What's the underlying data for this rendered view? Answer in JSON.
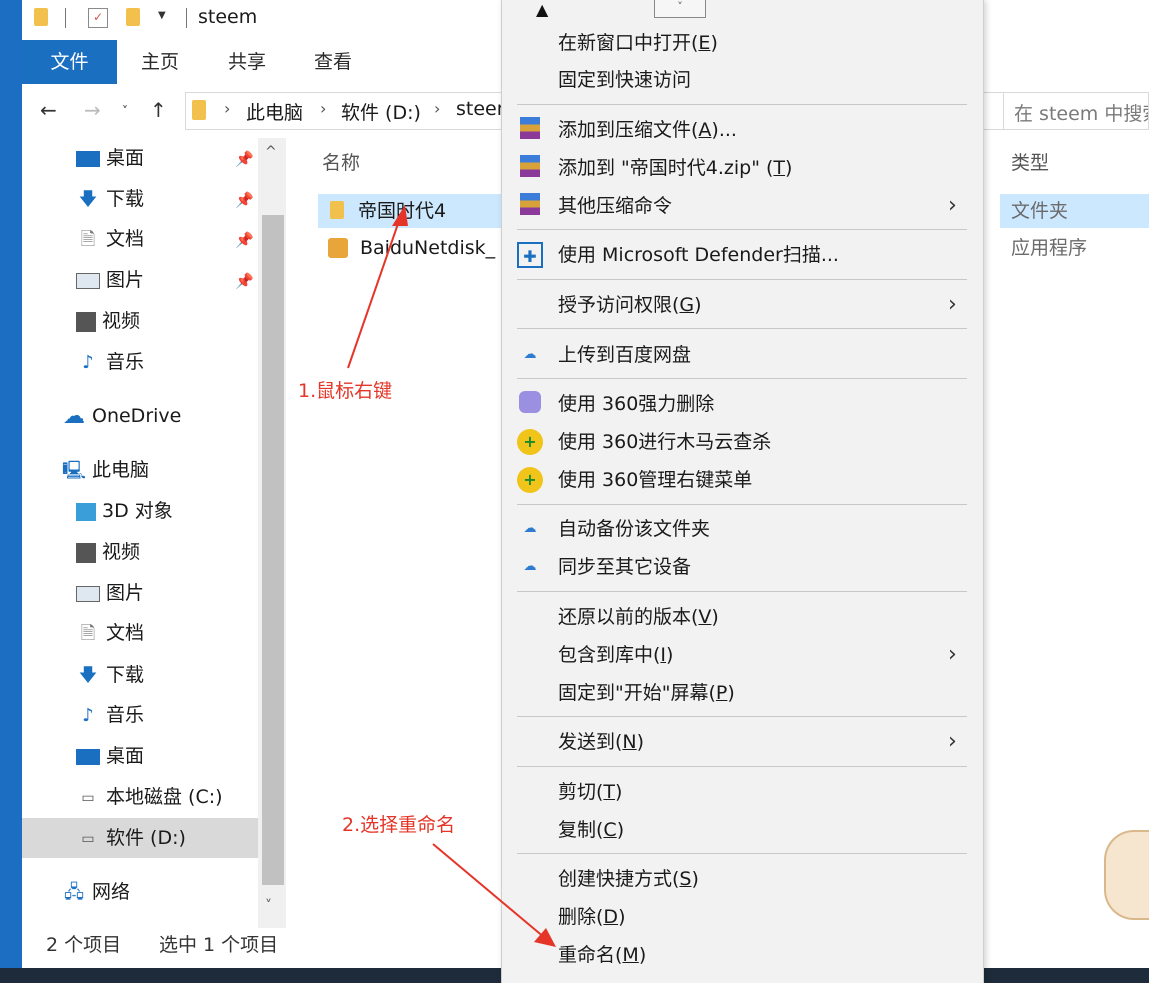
{
  "window": {
    "title": "steem"
  },
  "ribbon": {
    "tabs": [
      "文件",
      "主页",
      "共享",
      "查看"
    ]
  },
  "address": {
    "crumbs": [
      "此电脑",
      "软件 (D:)",
      "steem"
    ],
    "search_placeholder": "在 steem 中搜索"
  },
  "nav": {
    "quick": [
      {
        "label": "桌面",
        "icon": "desktop-icon",
        "pinned": true
      },
      {
        "label": "下载",
        "icon": "download-icon",
        "pinned": true
      },
      {
        "label": "文档",
        "icon": "document-icon",
        "pinned": true
      },
      {
        "label": "图片",
        "icon": "picture-icon",
        "pinned": true
      },
      {
        "label": "视频",
        "icon": "video-icon",
        "pinned": false
      },
      {
        "label": "音乐",
        "icon": "music-icon",
        "pinned": false
      }
    ],
    "onedrive": "OneDrive",
    "thispc": "此电脑",
    "pc_items": [
      {
        "label": "3D 对象",
        "icon": "cube-icon"
      },
      {
        "label": "视频",
        "icon": "video-icon"
      },
      {
        "label": "图片",
        "icon": "picture-icon"
      },
      {
        "label": "文档",
        "icon": "document-icon"
      },
      {
        "label": "下载",
        "icon": "download-icon"
      },
      {
        "label": "音乐",
        "icon": "music-icon"
      },
      {
        "label": "桌面",
        "icon": "desktop-icon"
      },
      {
        "label": "本地磁盘 (C:)",
        "icon": "drive-c-icon"
      },
      {
        "label": "软件 (D:)",
        "icon": "drive-d-icon"
      }
    ],
    "network": "网络"
  },
  "files": {
    "col_name": "名称",
    "col_type": "类型",
    "rows": [
      {
        "name": "帝国时代4",
        "type": "文件夹",
        "selected": true
      },
      {
        "name": "BaiduNetdisk_",
        "type": "应用程序",
        "selected": false
      }
    ]
  },
  "status": {
    "count": "2 个项目",
    "selection": "选中 1 个项目"
  },
  "context_menu": {
    "items": [
      {
        "pre": "在新窗口中打开(",
        "key": "E",
        "post": ")",
        "icon": ""
      },
      {
        "pre": "固定到快速访问",
        "key": "",
        "post": "",
        "icon": ""
      },
      {
        "pre": "添加到压缩文件(",
        "key": "A",
        "post": ")...",
        "icon": "winrar-icon"
      },
      {
        "pre": "添加到 \"帝国时代4.zip\" (",
        "key": "T",
        "post": ")",
        "icon": "winrar-icon"
      },
      {
        "pre": "其他压缩命令",
        "key": "",
        "post": "",
        "icon": "winrar-icon",
        "submenu": true
      },
      {
        "pre": "使用 Microsoft Defender扫描...",
        "key": "",
        "post": "",
        "icon": "defender-shield-icon"
      },
      {
        "pre": "授予访问权限(",
        "key": "G",
        "post": ")",
        "icon": "",
        "submenu": true
      },
      {
        "pre": "上传到百度网盘",
        "key": "",
        "post": "",
        "icon": "baidu-cloud-icon"
      },
      {
        "pre": "使用 360强力删除",
        "key": "",
        "post": "",
        "icon": "360-shredder-icon"
      },
      {
        "pre": "使用 360进行木马云查杀",
        "key": "",
        "post": "",
        "icon": "360-icon"
      },
      {
        "pre": "使用 360管理右键菜单",
        "key": "",
        "post": "",
        "icon": "360-icon"
      },
      {
        "pre": "自动备份该文件夹",
        "key": "",
        "post": "",
        "icon": "baidu-cloud-icon"
      },
      {
        "pre": "同步至其它设备",
        "key": "",
        "post": "",
        "icon": "baidu-cloud-icon"
      },
      {
        "pre": "还原以前的版本(",
        "key": "V",
        "post": ")",
        "icon": ""
      },
      {
        "pre": "包含到库中(",
        "key": "I",
        "post": ")",
        "icon": "",
        "submenu": true
      },
      {
        "pre": "固定到\"开始\"屏幕(",
        "key": "P",
        "post": ")",
        "icon": ""
      },
      {
        "pre": "发送到(",
        "key": "N",
        "post": ")",
        "icon": "",
        "submenu": true
      },
      {
        "pre": "剪切(",
        "key": "T",
        "post": ")",
        "icon": ""
      },
      {
        "pre": "复制(",
        "key": "C",
        "post": ")",
        "icon": ""
      },
      {
        "pre": "创建快捷方式(",
        "key": "S",
        "post": ")",
        "icon": ""
      },
      {
        "pre": "删除(",
        "key": "D",
        "post": ")",
        "icon": ""
      },
      {
        "pre": "重命名(",
        "key": "M",
        "post": ")",
        "icon": ""
      }
    ]
  },
  "annotations": {
    "step1": "1.鼠标右键",
    "step2": "2.选择重命名"
  },
  "colors": {
    "accent": "#1a6fc1",
    "selection": "#cce8ff",
    "annotation": "#e53528"
  }
}
